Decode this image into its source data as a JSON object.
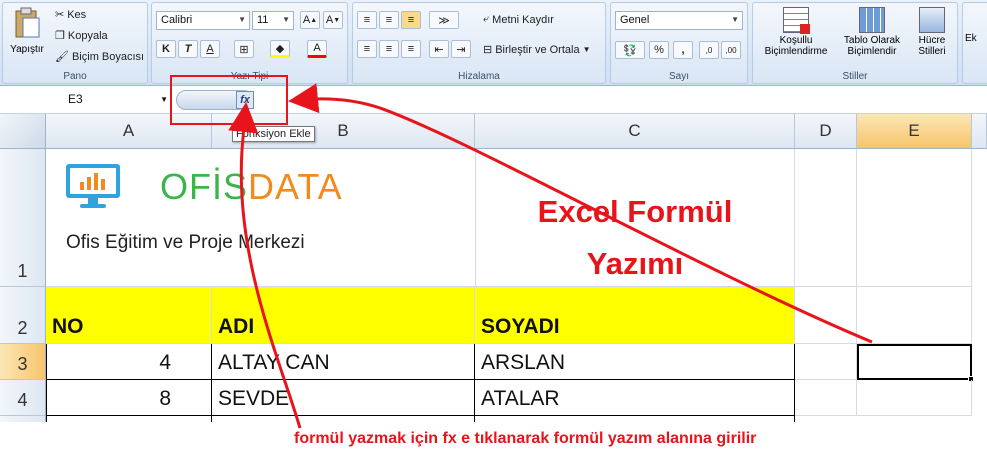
{
  "ribbon": {
    "clipboard": {
      "paste": "Yapıştır",
      "cut": "Kes",
      "copy": "Kopyala",
      "format_painter": "Biçim Boyacısı",
      "group_label": "Pano"
    },
    "font": {
      "name": "Calibri",
      "size": "11",
      "group_label": "Yazı Tipi"
    },
    "alignment": {
      "wrap": "Metni Kaydır",
      "merge": "Birleştir ve Ortala",
      "group_label": "Hizalama"
    },
    "number": {
      "format": "Genel",
      "group_label": "Sayı",
      "currency": "%",
      "comma": ","
    },
    "styles": {
      "conditional_1": "Koşullu",
      "conditional_2": "Biçimlendirme",
      "table_1": "Tablo Olarak",
      "table_2": "Biçimlendir",
      "cell_1": "Hücre",
      "cell_2": "Stilleri",
      "group_label": "Stiller"
    },
    "cells": {
      "insert": "Ek"
    }
  },
  "formula_bar": {
    "name_box": "E3",
    "fx": "fx",
    "tooltip": "Fonksiyon Ekle"
  },
  "columns": [
    "A",
    "B",
    "C",
    "D",
    "E"
  ],
  "rows": [
    "1",
    "2",
    "3",
    "4"
  ],
  "logo": {
    "brand_a": "OFİS",
    "brand_b": "DATA",
    "subtitle": "Ofis Eğitim ve Proje Merkezi"
  },
  "header_row": {
    "no": "NO",
    "adi": "ADI",
    "soyadi": "SOYADI"
  },
  "data_rows": [
    {
      "no": "4",
      "adi": "ALTAY CAN",
      "soyadi": "ARSLAN"
    },
    {
      "no": "8",
      "adi": "SEVDE",
      "soyadi": "ATALAR"
    }
  ],
  "annotation": {
    "title_line1": "Excel Formül",
    "title_line2": "Yazımı",
    "caption": "formül yazmak için fx e tıklanarak formül yazım alanına girilir",
    "color": "#e8141b"
  }
}
